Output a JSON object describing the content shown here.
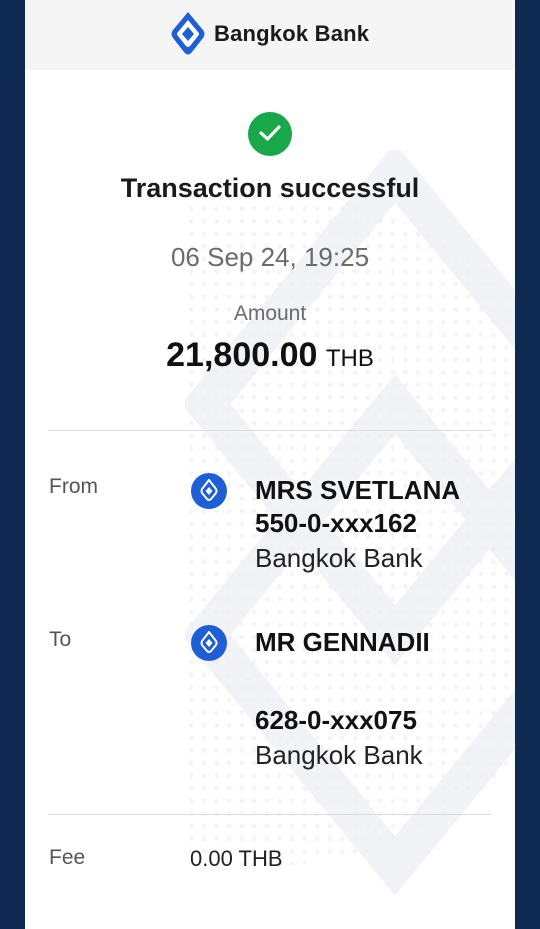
{
  "header": {
    "brand_name": "Bangkok Bank"
  },
  "status": {
    "title": "Transaction successful",
    "datetime": "06 Sep 24, 19:25"
  },
  "amount": {
    "label": "Amount",
    "value": "21,800.00",
    "currency": "THB"
  },
  "from": {
    "label": "From",
    "name": "MRS SVETLANA",
    "account": "550-0-xxx162",
    "bank": "Bangkok Bank"
  },
  "to": {
    "label": "To",
    "name": "MR GENNADII",
    "account": "628-0-xxx075",
    "bank": "Bangkok Bank"
  },
  "fee": {
    "label": "Fee",
    "value": "0.00 THB"
  },
  "colors": {
    "brand_blue": "#1f5fd6",
    "success_green": "#18a84a",
    "frame_navy": "#0f2a52"
  },
  "icons": {
    "logo": "bangkok-bank-logo-icon",
    "success": "check-circle-icon",
    "bank": "bangkok-bank-icon"
  }
}
